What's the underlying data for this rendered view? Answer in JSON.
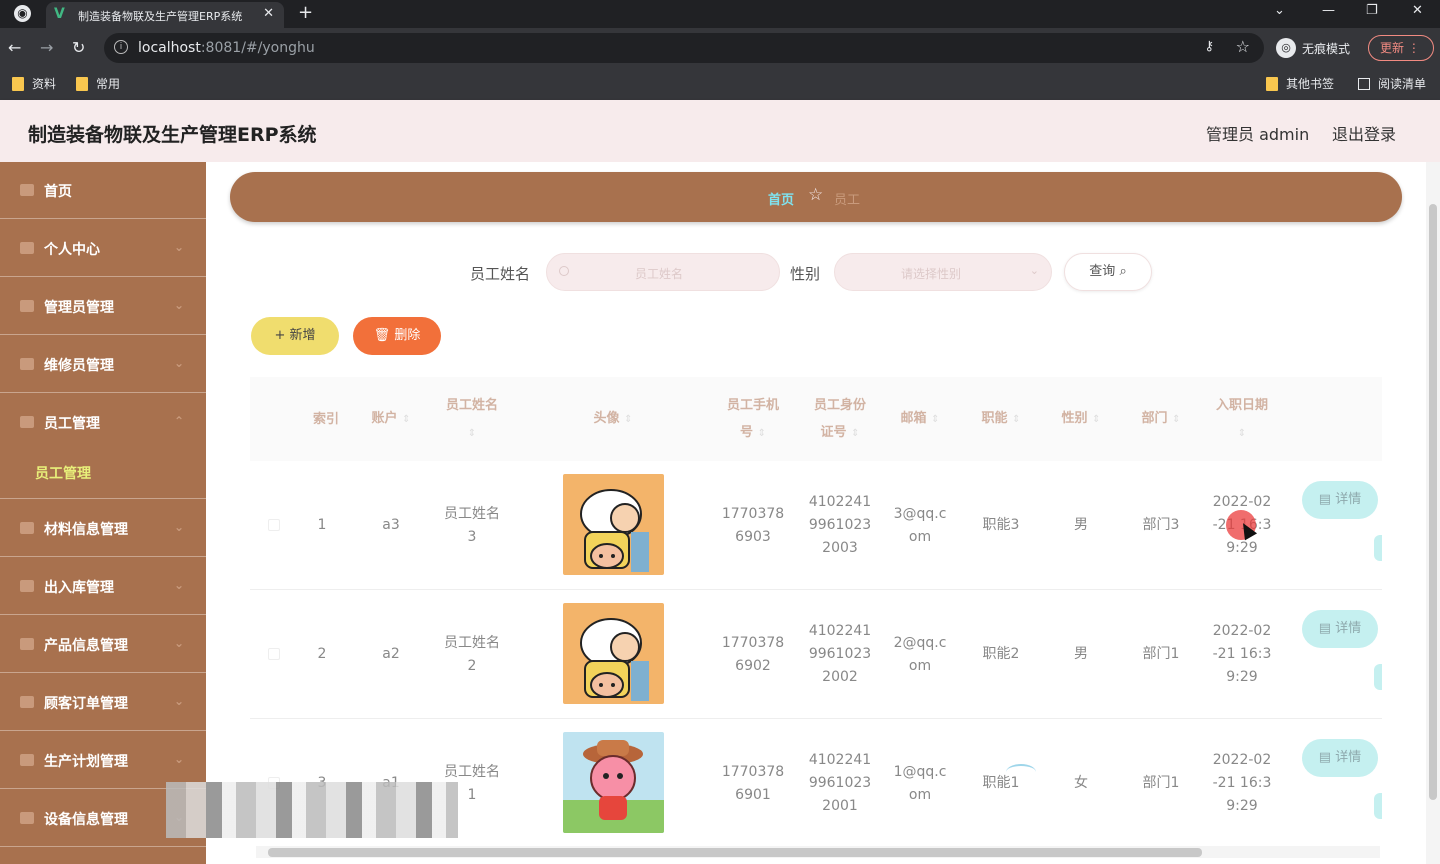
{
  "browser": {
    "tab_title": "制造装备物联及生产管理ERP系统",
    "tab_icon": "vue-icon",
    "url_host": "localhost",
    "url_rest": ":8081/#/yonghu",
    "incognito_label": "无痕模式",
    "update_label": "更新",
    "bookmarks": [
      "资料",
      "常用"
    ],
    "other_bookmarks": "其他书签",
    "reading_list": "阅读清单"
  },
  "header": {
    "title": "制造装备物联及生产管理ERP系统",
    "user": "管理员 admin",
    "logout": "退出登录"
  },
  "sidebar": {
    "items": [
      {
        "label": "首页"
      },
      {
        "label": "个人中心"
      },
      {
        "label": "管理员管理"
      },
      {
        "label": "维修员管理"
      },
      {
        "label": "员工管理"
      },
      {
        "label": "材料信息管理"
      },
      {
        "label": "出入库管理"
      },
      {
        "label": "产品信息管理"
      },
      {
        "label": "顾客订单管理"
      },
      {
        "label": "生产计划管理"
      },
      {
        "label": "设备信息管理"
      }
    ],
    "sub_item": "员工管理"
  },
  "breadcrumb": {
    "home": "首页",
    "current": "员工"
  },
  "search": {
    "name_label": "员工姓名",
    "name_placeholder": "员工姓名",
    "gender_label": "性别",
    "gender_placeholder": "请选择性别",
    "query_button": "查询"
  },
  "actions": {
    "add": "新增",
    "delete": "删除"
  },
  "table": {
    "headers": {
      "index": "索引",
      "account": "账户",
      "name1": "员工姓名",
      "avatar": "头像",
      "phone1": "员工手机",
      "phone2": "号",
      "id1": "员工身份",
      "id2": "证号",
      "email": "邮箱",
      "duty": "职能",
      "gender": "性别",
      "dept": "部门",
      "hire1": "入职日期"
    },
    "detail_label": "详情",
    "rows": [
      {
        "index": "1",
        "account": "a3",
        "name_a": "员工姓名",
        "name_b": "3",
        "phone_a": "1770378",
        "phone_b": "6903",
        "id_a": "4102241",
        "id_b": "9961023",
        "id_c": "2003",
        "email_a": "3@qq.c",
        "email_b": "om",
        "duty": "职能3",
        "gender": "男",
        "dept": "部门3",
        "date_a": "2022-02",
        "date_b": "-21 16:3",
        "date_c": "9:29"
      },
      {
        "index": "2",
        "account": "a2",
        "name_a": "员工姓名",
        "name_b": "2",
        "phone_a": "1770378",
        "phone_b": "6902",
        "id_a": "4102241",
        "id_b": "9961023",
        "id_c": "2002",
        "email_a": "2@qq.c",
        "email_b": "om",
        "duty": "职能2",
        "gender": "男",
        "dept": "部门1",
        "date_a": "2022-02",
        "date_b": "-21 16:3",
        "date_c": "9:29"
      },
      {
        "index": "3",
        "account": "a1",
        "name_a": "员工姓名",
        "name_b": "1",
        "phone_a": "1770378",
        "phone_b": "6901",
        "id_a": "4102241",
        "id_b": "9961023",
        "id_c": "2001",
        "email_a": "1@qq.c",
        "email_b": "om",
        "duty": "职能1",
        "gender": "女",
        "dept": "部门1",
        "date_a": "2022-02",
        "date_b": "-21 16:3",
        "date_c": "9:29"
      }
    ]
  },
  "colors": {
    "sidebar": "#a8714e",
    "header_bg": "#f7ebec",
    "add_button": "#f0dd6e",
    "delete_button": "#f2703a",
    "detail_button": "#c5f0f0",
    "breadcrumb_home": "#7fe3f0"
  }
}
